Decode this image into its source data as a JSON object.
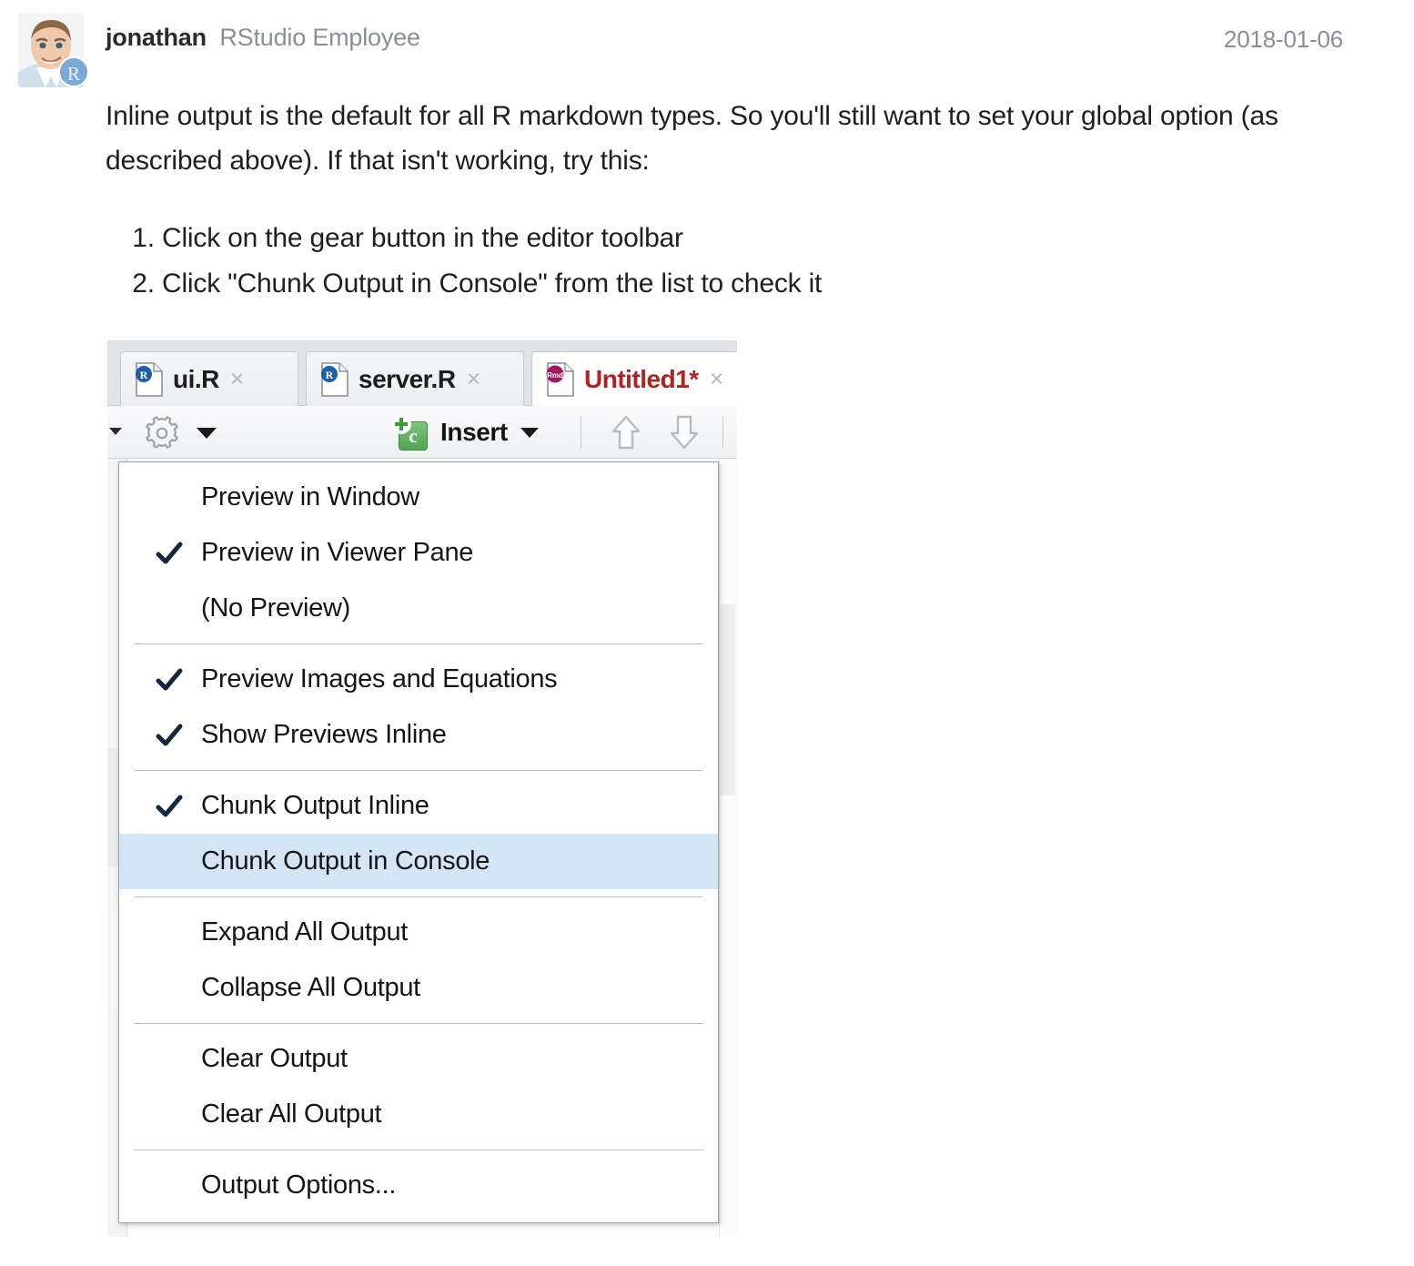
{
  "post": {
    "author": "jonathan",
    "role": "RStudio Employee",
    "date": "2018-01-06",
    "avatar_badge": "R",
    "paragraph": "Inline output is the default for all R markdown types. So you'll still want to set your global option (as described above). If that isn't working, try this:",
    "steps": [
      "Click on the gear button in the editor toolbar",
      "Click \"Chunk Output in Console\" from the list to check it"
    ]
  },
  "rstudio": {
    "tabs": [
      {
        "label": "ui.R",
        "close": "×",
        "active": false
      },
      {
        "label": "server.R",
        "close": "×",
        "active": false
      },
      {
        "label": "Untitled1*",
        "close": "×",
        "active": true
      }
    ],
    "toolbar": {
      "insert_label": "Insert",
      "chunk_letter": "c"
    },
    "menu": [
      {
        "label": "Preview in Window",
        "checked": false,
        "selected": false,
        "sep_after": false
      },
      {
        "label": "Preview in Viewer Pane",
        "checked": true,
        "selected": false,
        "sep_after": false
      },
      {
        "label": "(No Preview)",
        "checked": false,
        "selected": false,
        "sep_after": true
      },
      {
        "label": "Preview Images and Equations",
        "checked": true,
        "selected": false,
        "sep_after": false
      },
      {
        "label": "Show Previews Inline",
        "checked": true,
        "selected": false,
        "sep_after": true
      },
      {
        "label": "Chunk Output Inline",
        "checked": true,
        "selected": false,
        "sep_after": false
      },
      {
        "label": "Chunk Output in Console",
        "checked": false,
        "selected": true,
        "sep_after": true
      },
      {
        "label": "Expand All Output",
        "checked": false,
        "selected": false,
        "sep_after": false
      },
      {
        "label": "Collapse All Output",
        "checked": false,
        "selected": false,
        "sep_after": true
      },
      {
        "label": "Clear Output",
        "checked": false,
        "selected": false,
        "sep_after": false
      },
      {
        "label": "Clear All Output",
        "checked": false,
        "selected": false,
        "sep_after": true
      },
      {
        "label": "Output Options...",
        "checked": false,
        "selected": false,
        "sep_after": false
      }
    ]
  },
  "colors": {
    "menu_highlight": "#d4e6f6",
    "active_tab_text": "#b22222",
    "muted_text": "#8a8f94",
    "chunk_green": "#53a553",
    "badge_blue": "#7aa9d6"
  }
}
